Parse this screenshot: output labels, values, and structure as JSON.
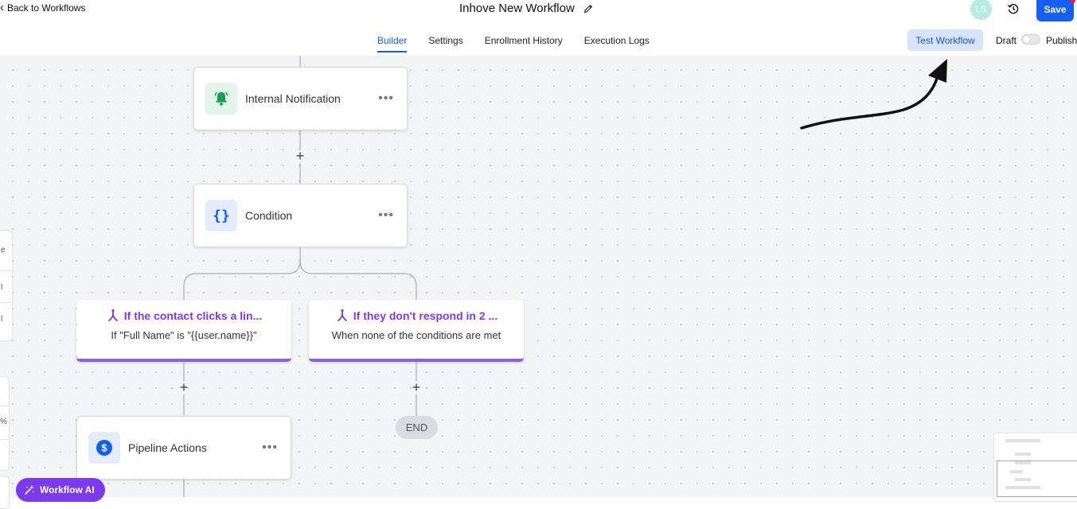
{
  "header": {
    "back_label": "Back to Workflows",
    "title": "Inhove New Workflow",
    "avatar_initials": "LS",
    "save_label": "Save",
    "tabs": [
      {
        "label": "Builder",
        "active": true
      },
      {
        "label": "Settings",
        "active": false
      },
      {
        "label": "Enrollment History",
        "active": false
      },
      {
        "label": "Execution Logs",
        "active": false
      }
    ],
    "test_label": "Test Workflow",
    "draft_label": "Draft",
    "publish_label": "Publish",
    "published": false
  },
  "nodes": {
    "internal_notification": {
      "label": "Internal Notification",
      "icon": "bell-icon",
      "color": "#1f9d55"
    },
    "condition": {
      "label": "Condition",
      "icon": "braces-icon",
      "color": "#155eef"
    },
    "pipeline_actions": {
      "label": "Pipeline Actions",
      "icon": "dollar-icon",
      "color": "#155eef"
    }
  },
  "branches": [
    {
      "title": "If the contact clicks a lin...",
      "subtitle": "If \"Full Name\" is \"{{user.name}}\""
    },
    {
      "title": "If they don't respond in 2 ...",
      "subtitle": "When none of the conditions are met"
    }
  ],
  "end_label": "END",
  "side": {
    "chars": [
      "e",
      "l",
      "l",
      "%"
    ]
  },
  "ai_button": {
    "label": "Workflow AI"
  },
  "colors": {
    "accent": "#155eef",
    "branch": "#7c3aed",
    "canvas": "#f3f4f6"
  }
}
